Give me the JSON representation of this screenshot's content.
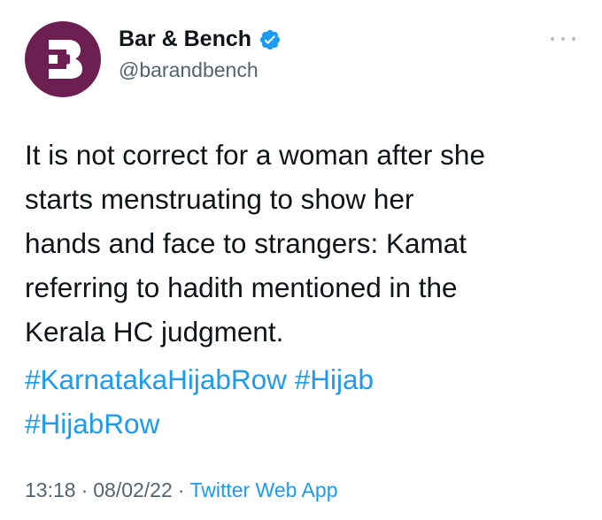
{
  "author": {
    "display_name": "Bar & Bench",
    "handle": "@barandbench",
    "verified": true,
    "avatar_color": "#6e1f52"
  },
  "tweet": {
    "text_lines": [
      "It is not correct for a woman after she",
      "starts menstruating to show her",
      "hands and face to strangers: Kamat",
      "referring to hadith mentioned in the",
      "Kerala HC judgment."
    ],
    "hashtags": [
      "#KarnatakaHijabRow",
      "#Hijab",
      "#HijabRow"
    ]
  },
  "meta": {
    "time": "13:18",
    "separator": "·",
    "date": "08/02/22",
    "source": "Twitter Web App"
  },
  "colors": {
    "link": "#1d9bf0",
    "secondary_text": "#536471",
    "verified_badge": "#1d9bf0"
  },
  "icons": {
    "more": "more-horizontal-icon",
    "verified": "verified-badge-icon",
    "avatar_logo": "bar-and-bench-logo"
  }
}
